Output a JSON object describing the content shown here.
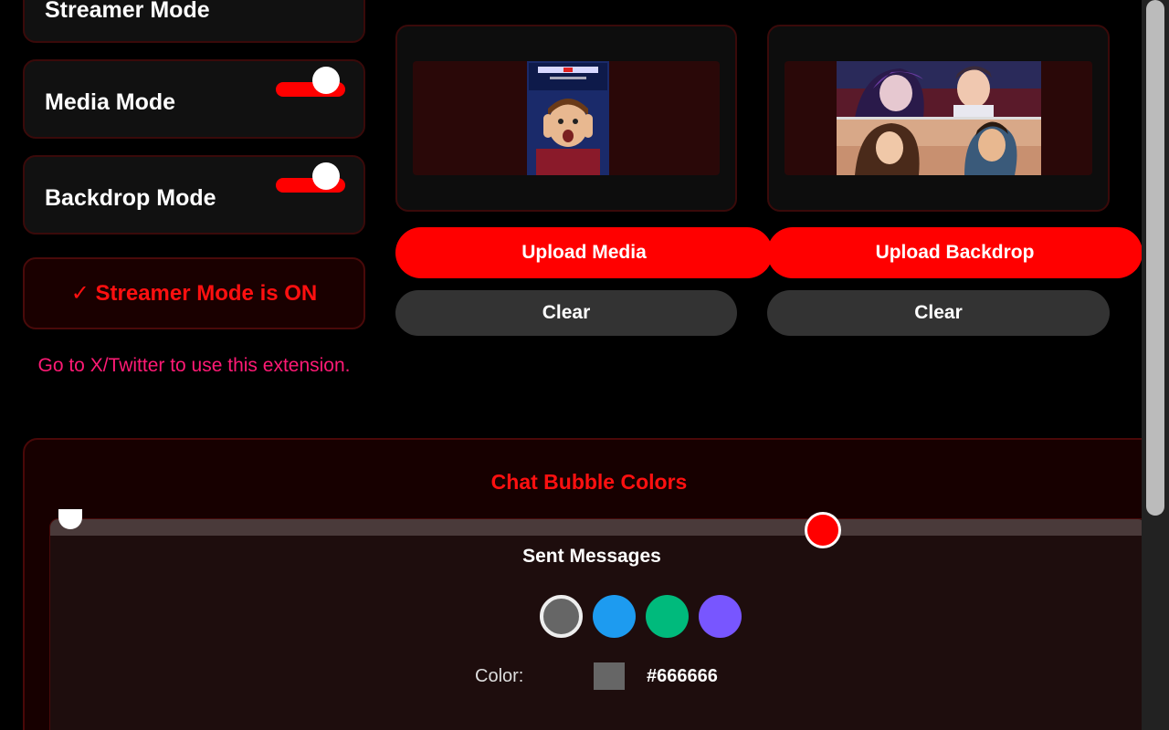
{
  "modes": [
    {
      "label": "Streamer Mode"
    },
    {
      "label": "Media Mode",
      "enabled": true
    },
    {
      "label": "Backdrop Mode",
      "enabled": true
    }
  ],
  "status": {
    "text": "✓ Streamer Mode is ON",
    "color": "#ff1010"
  },
  "hint": {
    "text": "Go to X/Twitter to use this extension.",
    "color": "#ff1a75"
  },
  "media": {
    "upload_label": "Upload Media",
    "clear_label": "Clear"
  },
  "backdrop": {
    "upload_label": "Upload Backdrop",
    "clear_label": "Clear"
  },
  "chat_colors": {
    "title": "Chat Bubble Colors",
    "sent": {
      "label": "Sent Messages",
      "swatches": [
        {
          "color": "#666666",
          "selected": true
        },
        {
          "color": "#1d9bf0"
        },
        {
          "color": "#00ba7c"
        },
        {
          "color": "#7856ff"
        }
      ],
      "color_label": "Color:",
      "hex": "#666666"
    }
  },
  "colors": {
    "accent": "#ff0000",
    "background": "#000000"
  }
}
